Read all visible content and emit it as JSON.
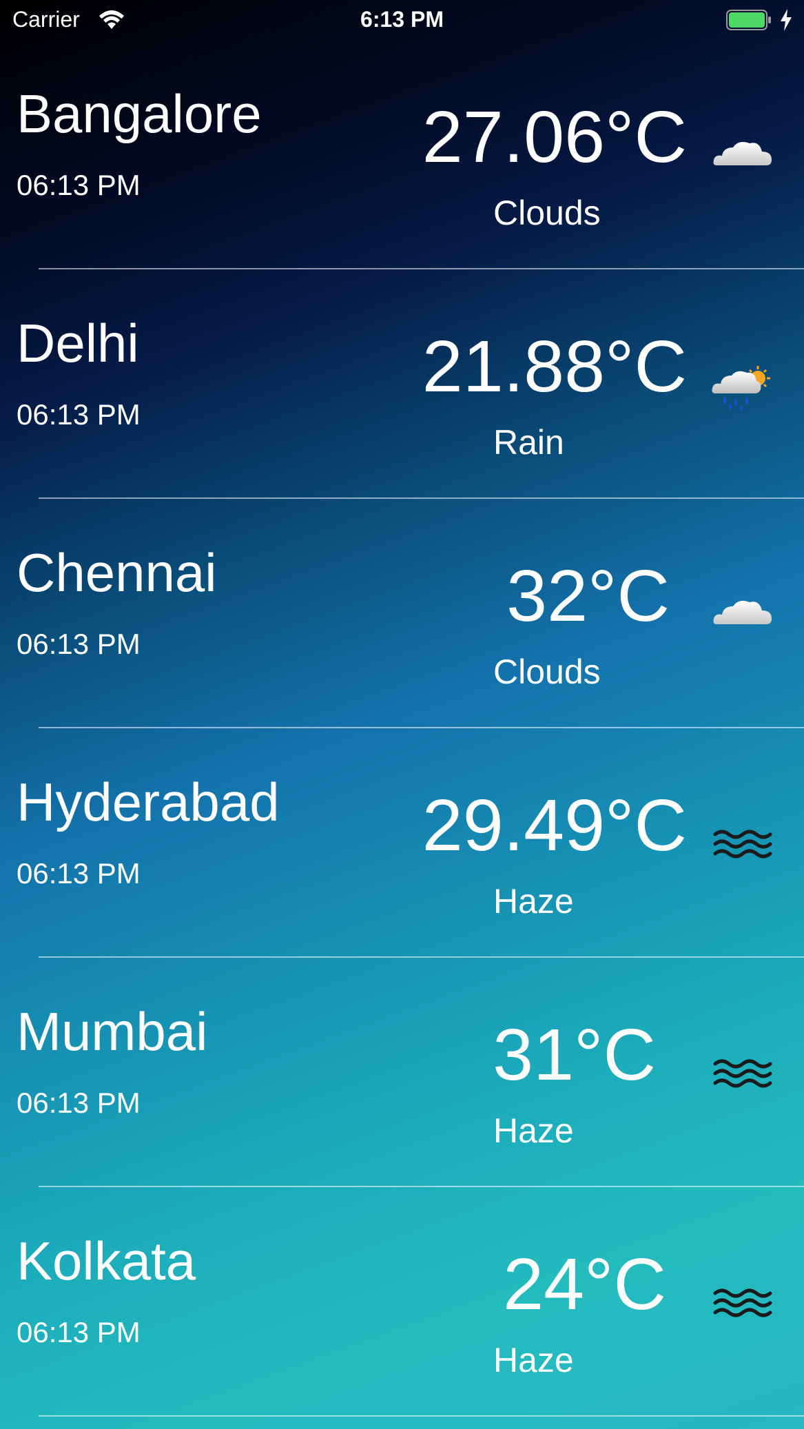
{
  "status_bar": {
    "carrier": "Carrier",
    "time": "6:13 PM",
    "icons": [
      "wifi-icon",
      "battery-icon",
      "charging-bolt-icon"
    ]
  },
  "cities": [
    {
      "name": "Bangalore",
      "time": "06:13 PM",
      "temperature": "27.06°C",
      "condition": "Clouds",
      "icon": "clouds-icon"
    },
    {
      "name": "Delhi",
      "time": "06:13 PM",
      "temperature": "21.88°C",
      "condition": "Rain",
      "icon": "rain-sun-icon"
    },
    {
      "name": "Chennai",
      "time": "06:13 PM",
      "temperature": "32°C",
      "condition": "Clouds",
      "icon": "clouds-icon"
    },
    {
      "name": "Hyderabad",
      "time": "06:13 PM",
      "temperature": "29.49°C",
      "condition": "Haze",
      "icon": "haze-icon"
    },
    {
      "name": "Mumbai",
      "time": "06:13 PM",
      "temperature": "31°C",
      "condition": "Haze",
      "icon": "haze-icon"
    },
    {
      "name": "Kolkata",
      "time": "06:13 PM",
      "temperature": "24°C",
      "condition": "Haze",
      "icon": "haze-icon"
    }
  ],
  "colors": {
    "gradient_top": "#000000",
    "gradient_mid": "#1473ac",
    "gradient_bottom": "#23bbbe",
    "battery_fill": "#4cd964"
  }
}
